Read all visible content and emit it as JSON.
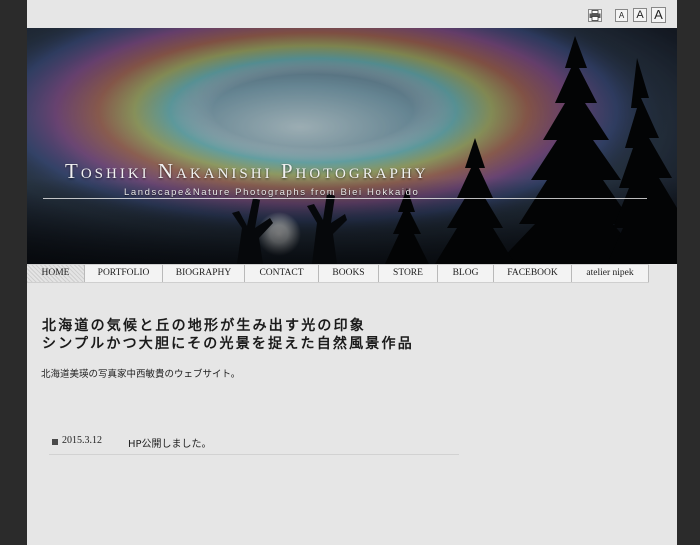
{
  "utility": {
    "print_icon": "printer-icon",
    "font_sizes": [
      "A",
      "A",
      "A"
    ]
  },
  "banner": {
    "title": "Toshiki Nakanishi Photography",
    "subtitle": "Landscape&Nature Photographs from Biei Hokkaido"
  },
  "nav": {
    "items": [
      {
        "label": "HOME",
        "active": true
      },
      {
        "label": "PORTFOLIO"
      },
      {
        "label": "BIOGRAPHY"
      },
      {
        "label": "CONTACT"
      },
      {
        "label": "BOOKS"
      },
      {
        "label": "STORE"
      },
      {
        "label": "BLOG"
      },
      {
        "label": "FACEBOOK"
      },
      {
        "label": "atelier nipek"
      }
    ]
  },
  "main": {
    "headline_line1": "北海道の気候と丘の地形が生み出す光の印象",
    "headline_line2": "シンプルかつ大胆にその光景を捉えた自然風景作品",
    "intro": "北海道美瑛の写真家中西敏貴のウェブサイト。"
  },
  "news": [
    {
      "date": "2015.3.12",
      "text": "HP公開しました。"
    }
  ],
  "colors": {
    "outer_background": "#2b2b2b",
    "page_background": "#e6e6e6",
    "nav_background": "#f3f3f3"
  }
}
